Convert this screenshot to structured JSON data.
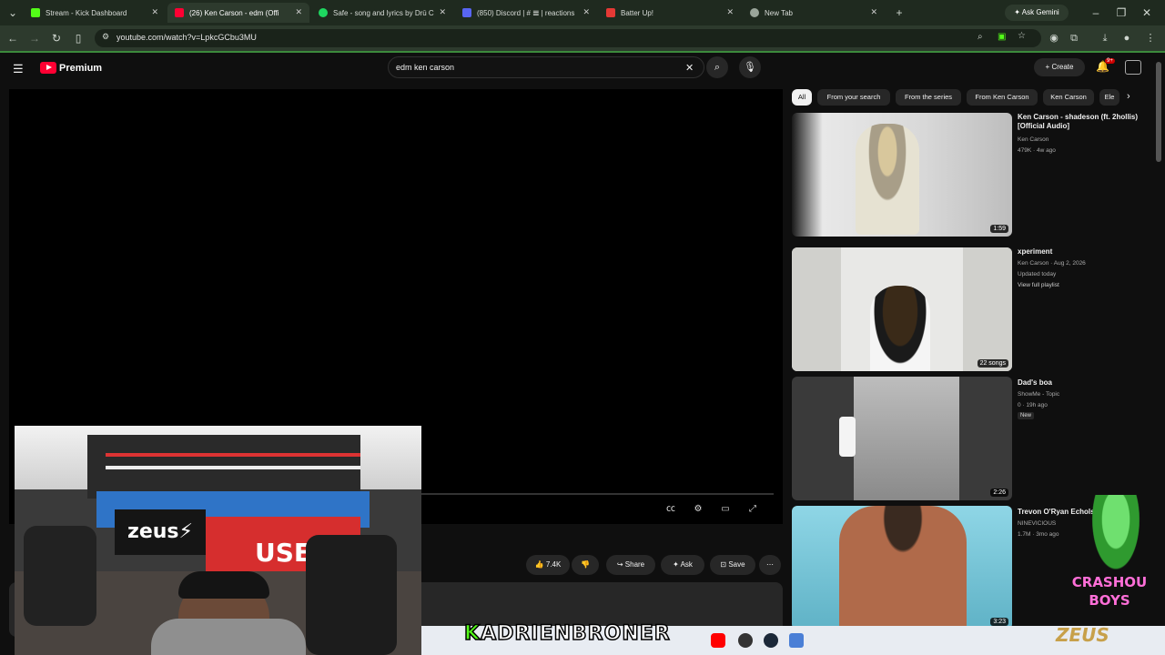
{
  "browser": {
    "tabs": [
      {
        "title": "Stream - Kick Dashboard",
        "color": "#53fc18"
      },
      {
        "title": "(26) Ken Carson - edm (Offi",
        "color": "#ff0033"
      },
      {
        "title": "Safe - song and lyrics by Drū C",
        "color": "#1ed760"
      },
      {
        "title": "(850) Discord | # 𝌆 | reactions",
        "color": "#5865f2"
      },
      {
        "title": "Batter Up!",
        "color": "#e53935"
      },
      {
        "title": "New Tab",
        "color": "#9aa59a"
      }
    ],
    "gemini_label": "Ask Gemini",
    "url": "youtube.com/watch?v=LpkcGCbu3MU"
  },
  "youtube": {
    "brand": "Premium",
    "search_query": "edm ken carson",
    "create_label": "Create",
    "notif_count": "9+",
    "actions": {
      "likes": "7.4K",
      "share": "Share",
      "ask": "Ask",
      "save": "Save"
    },
    "chips": [
      "All",
      "From your search",
      "From the series",
      "From Ken Carson",
      "Ken Carson",
      "Ele"
    ],
    "related": [
      {
        "title": "Ken Carson - shadeson (ft. 2hollis) [Official Audio]",
        "channel": "Ken Carson",
        "meta": "479K · 4w ago",
        "duration": "1:59",
        "extra": "",
        "badge": ""
      },
      {
        "title": "xperiment",
        "channel": "Ken Carson · Aug 2, 2026",
        "meta": "Updated today",
        "duration": "22 songs",
        "extra": "View full playlist",
        "badge": ""
      },
      {
        "title": "Dad's boa",
        "channel": "ShowMe - Topic",
        "meta": "0 · 19h ago",
        "duration": "2:26",
        "extra": "",
        "badge": "New"
      },
      {
        "title": "Trevon O'Ryan Echols",
        "channel": "NINEVICIOUS",
        "meta": "1.7M · 3mo ago",
        "duration": "3:23",
        "extra": "",
        "badge": ""
      }
    ]
  },
  "overlay": {
    "streamer_k": "K",
    "streamer_name": "ADRIENBRONER",
    "crash_line1": "CRASHOU",
    "crash_line2": "BOYS",
    "zeus": "ZEUS"
  }
}
